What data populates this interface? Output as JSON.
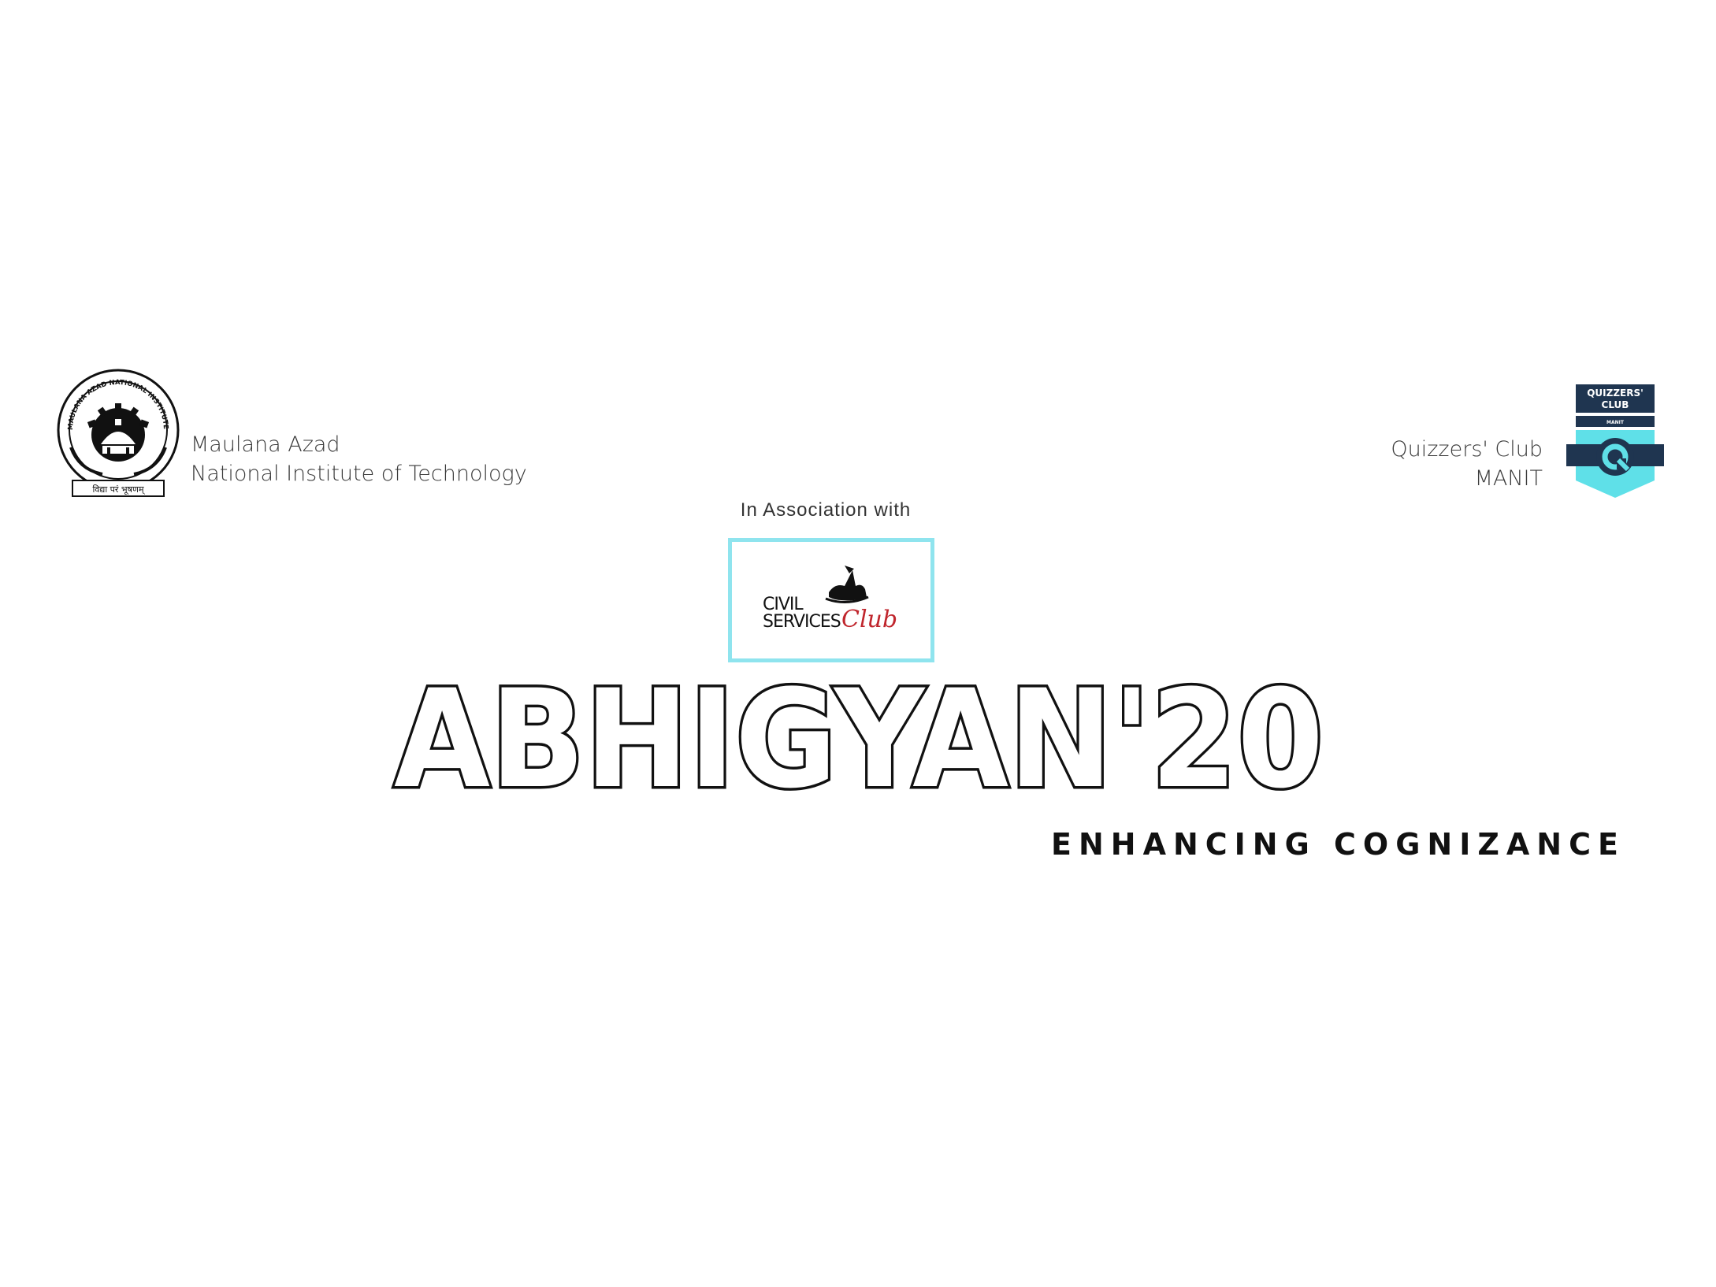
{
  "institute": {
    "line1": "Maulana Azad",
    "line2": "National Institute of Technology",
    "seal_text": "MAULANA AZAD NATIONAL INSTITUTE OF TECHNOLOGY BHOPAL",
    "motto": "विद्या परं भूषणम्"
  },
  "club": {
    "line1": "Quizzers' Club",
    "line2": "MANIT",
    "badge_line1": "QUIZZERS'",
    "badge_line2": "CLUB",
    "badge_line3": "MANIT",
    "colors": {
      "navy": "#1f3550",
      "teal": "#5fe0e8"
    }
  },
  "association": {
    "label": "In Association with",
    "partner_line1": "CIVIL",
    "partner_line2": "SERVICES",
    "partner_script": "Club",
    "box_color": "#8fe4ee",
    "script_color": "#c0262d"
  },
  "event": {
    "title": "ABHIGYAN'20",
    "tagline": "ENHANCING COGNIZANCE"
  }
}
